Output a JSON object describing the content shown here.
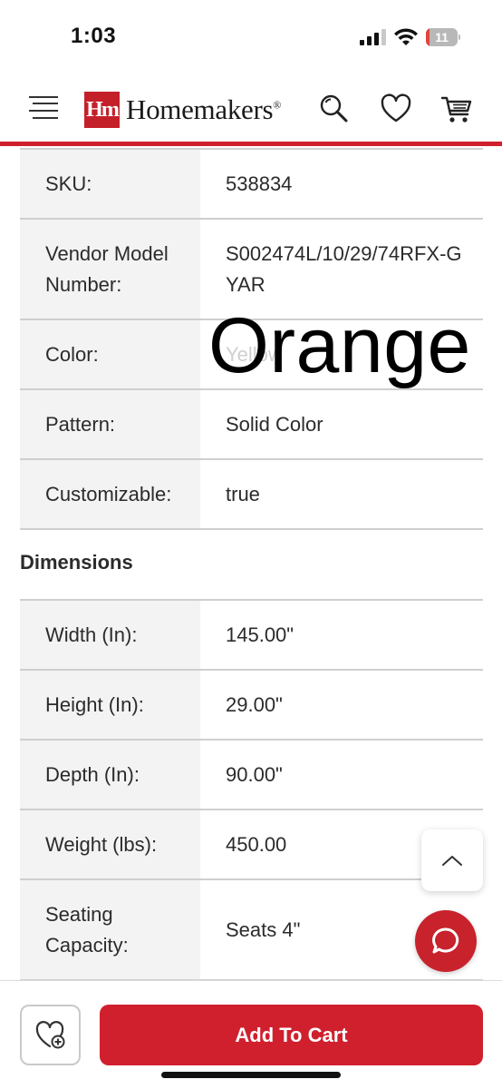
{
  "status_bar": {
    "time": "1:03",
    "battery_level": "11",
    "battery_fraction": 0.11,
    "signal_bars_active": 3,
    "signal_bars_total": 4
  },
  "header": {
    "logo_mark": "Hm",
    "logo_text": "Homemakers",
    "logo_registered": "®",
    "icons": [
      "menu-icon",
      "search-icon",
      "heart-icon",
      "cart-icon"
    ],
    "accent_color": "#d0202e"
  },
  "specs": [
    {
      "label": "SKU:",
      "value": "538834"
    },
    {
      "label": "Vendor Model Number:",
      "value": "S002474L/10/29/74RFX-GYAR"
    },
    {
      "label": "Color:",
      "value": "Yellow",
      "overlay": "Orange"
    },
    {
      "label": "Pattern:",
      "value": "Solid Color"
    },
    {
      "label": "Customizable:",
      "value": "true"
    }
  ],
  "dimensions": {
    "title": "Dimensions",
    "rows": [
      {
        "label": "Width (In):",
        "value": "145.00\""
      },
      {
        "label": "Height (In):",
        "value": "29.00\""
      },
      {
        "label": "Depth (In):",
        "value": "90.00\""
      },
      {
        "label": "Weight (lbs):",
        "value": "450.00"
      },
      {
        "label": "Seating Capacity:",
        "value": "Seats 4\""
      }
    ]
  },
  "actions": {
    "add_to_cart": "Add To Cart",
    "scroll_top_icon": "chevron-up-icon",
    "chat_icon": "chat-icon",
    "wishlist_icon": "heart-plus-icon"
  }
}
